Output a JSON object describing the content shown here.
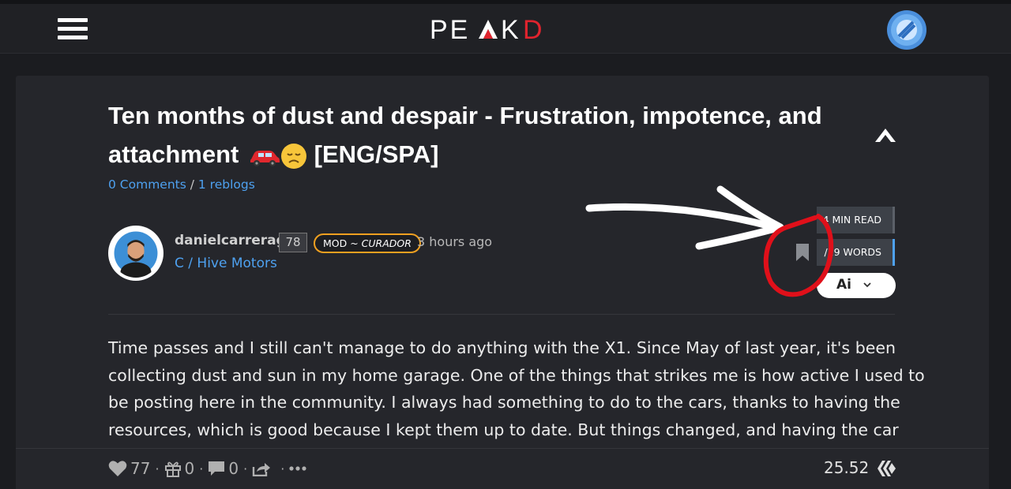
{
  "header": {
    "logo_text": "PEAKD",
    "menu_icon": "hamburger-menu-icon",
    "user_avatar": "user-avatar"
  },
  "post": {
    "title_line1": "Ten months of dust and despair - Frustration, impotence, and",
    "title_line2": "attachment",
    "title_emojis": [
      "red-car-emoji",
      "disappointed-face-emoji"
    ],
    "title_suffix": "[ENG/SPA]",
    "comments": "0 Comments",
    "separator": " / ",
    "reblogs": "1 reblogs",
    "author": {
      "name": "danielcarrerag",
      "reputation": "78",
      "role_prefix": "MOD ~ ",
      "role_title": "CURADOR",
      "time_ago": "3 hours ago",
      "community": "C / Hive Motors"
    },
    "stats": {
      "read_time": "4 MIN READ",
      "words": "719 WORDS",
      "words_visible": "/19 WORDS"
    },
    "ai_button_label": "Ai",
    "body_lines": [
      "Time passes and I still can't manage to do anything with the X1. Since May of last year, it's been",
      "collecting dust and sun in my home garage. One of the things that strikes me is how active I used to",
      "be posting here in the community. I always had something to do to the cars, thanks to having the",
      "resources, which is good because I kept them up to date. But things changed, and having the car"
    ]
  },
  "footer": {
    "votes": "77",
    "gifts": "0",
    "comments": "0",
    "payout": "25.52"
  },
  "colors": {
    "background": "#1b1c20",
    "card": "#25262b",
    "link": "#4ea1f0",
    "badge_border": "#f0a020",
    "logo_accent": "#e0242e",
    "annotation": "#e0101a"
  }
}
